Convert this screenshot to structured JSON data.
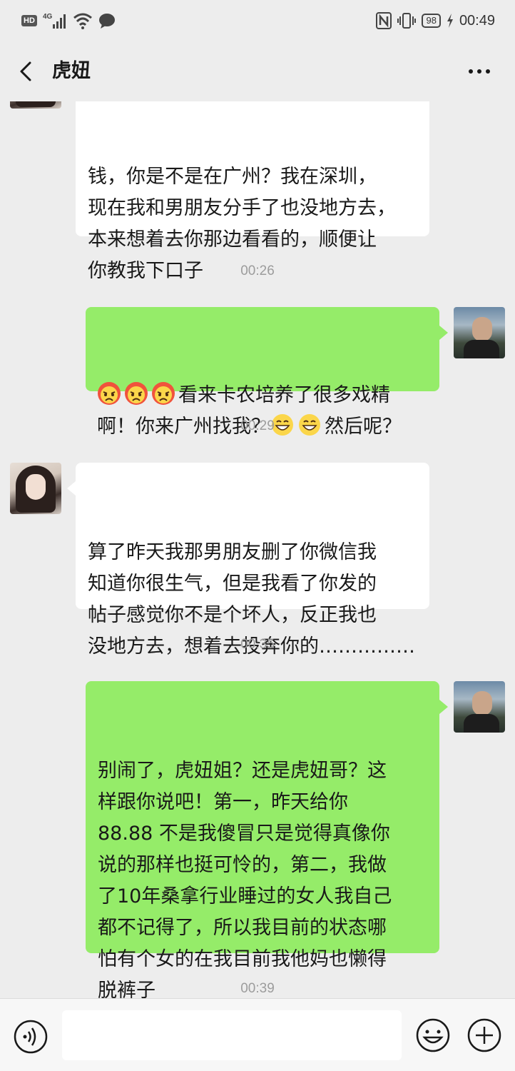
{
  "status_bar": {
    "hd": "HD",
    "network": "4G",
    "battery": "98",
    "time": "00:49"
  },
  "header": {
    "title": "虎妞"
  },
  "messages": [
    {
      "sender": "her",
      "lines": [
        "钱，你是不是在广州？我在深圳，",
        "现在我和男朋友分手了也没地方去，",
        "本来想着去你那边看看的，顺便让",
        "你教我下口子"
      ]
    },
    {
      "timestamp": "00:26"
    },
    {
      "sender": "me",
      "emoji_prefix": [
        "angry-face-emoji",
        "angry-face-emoji",
        "angry-face-emoji"
      ],
      "line1": "看来卡农培养了很多戏精",
      "line2_a": "啊！你来广州找我？",
      "line2_emoji": [
        "grinning-face-emoji",
        "grinning-face-emoji"
      ],
      "line2_b": "然后呢？"
    },
    {
      "timestamp": "00:29"
    },
    {
      "sender": "her",
      "lines": [
        "算了昨天我那男朋友删了你微信我",
        "知道你很生气，但是我看了你发的",
        "帖子感觉你不是个坏人，反正我也",
        "没地方去，想着去投奔你的……………"
      ]
    },
    {
      "timestamp": "00:35"
    },
    {
      "sender": "me",
      "lines": [
        "别闹了，虎妞姐？还是虎妞哥？这",
        "样跟你说吧！第一，昨天给你",
        "88.88 不是我傻冒只是觉得真像你",
        "说的那样也挺可怜的，第二，我做",
        "了10年桑拿行业睡过的女人我自己",
        "都不记得了，所以我目前的状态哪",
        "怕有个女的在我目前我他妈也懒得",
        "脱裤子"
      ]
    },
    {
      "timestamp": "00:39"
    }
  ],
  "input_bar": {
    "value": ""
  },
  "colors": {
    "background": "#ededed",
    "bubble_green": "#95ec69",
    "bubble_white": "#ffffff"
  }
}
